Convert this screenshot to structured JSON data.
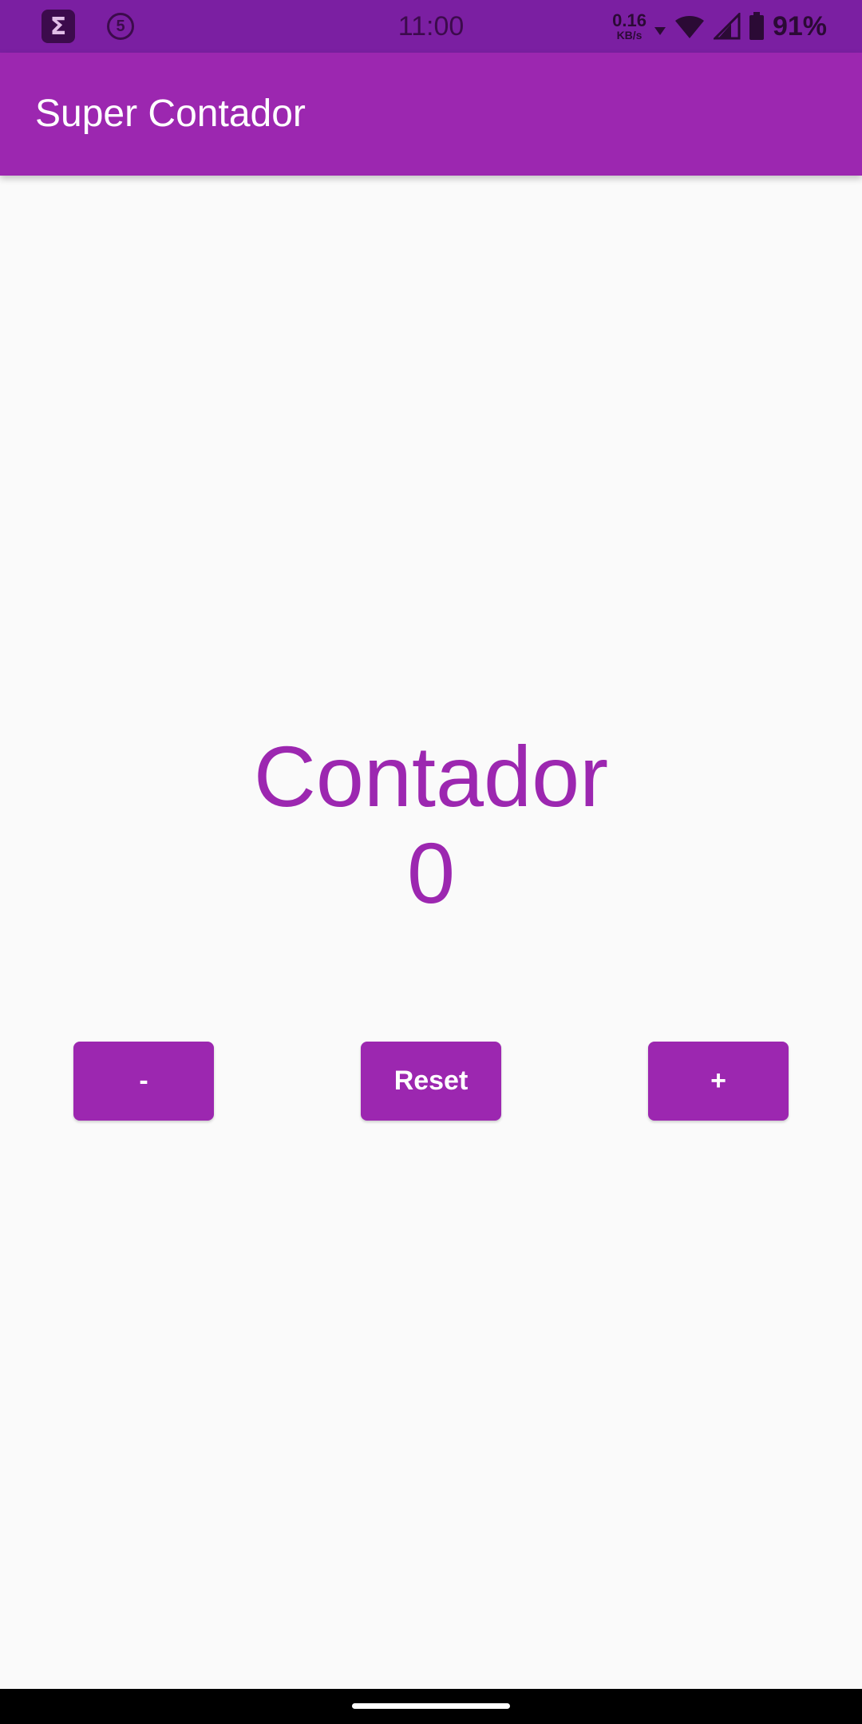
{
  "status_bar": {
    "time": "11:00",
    "notification_badge": "5",
    "sigma_glyph": "Σ",
    "net_speed_value": "0.16",
    "net_speed_unit": "KB/s",
    "battery_percent": "91%",
    "icons": [
      "sigma-app-icon",
      "badge-5-icon",
      "download-arrow-icon",
      "wifi-icon",
      "signal-icon",
      "battery-icon"
    ]
  },
  "app_bar": {
    "title": "Super Contador"
  },
  "counter": {
    "label": "Contador",
    "value": "0"
  },
  "buttons": {
    "minus": "-",
    "reset": "Reset",
    "plus": "+"
  },
  "colors": {
    "primary": "#9c27b0",
    "primary_dark": "#7b1fa2",
    "background": "#fafafa"
  }
}
